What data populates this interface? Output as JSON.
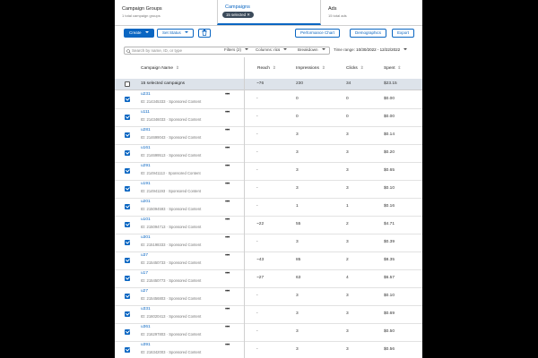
{
  "tabs": {
    "groups": {
      "title": "Campaign Groups",
      "sub": "1 total campaign groups"
    },
    "campaigns": {
      "title": "Campaigns",
      "chip": "15 selected",
      "chip_close": "✕"
    },
    "ads": {
      "title": "Ads",
      "sub": "15 total ads"
    }
  },
  "toolbar": {
    "create": "Create",
    "set_status": "Set Status",
    "delete_icon": "trash-icon",
    "performance_chart": "Performance Chart",
    "demographics": "Demographics",
    "export": "Export"
  },
  "search": {
    "placeholder": "Search by name, ID, or type"
  },
  "filters": {
    "filters_label": "Filters (2)",
    "columns_label": "Columns:",
    "columns_value": "rics",
    "breakdown_label": "Breakdown",
    "time_label": "Time range:",
    "time_value": "10/30/2022 - 12/22/2022"
  },
  "headers": {
    "name": "Campaign Name",
    "reach": "Reach",
    "impressions": "Impressions",
    "clicks": "Clicks",
    "spent": "Spent"
  },
  "summary": {
    "label": "15 selected campaigns",
    "reach": "~76",
    "impressions": "230",
    "clicks": "34",
    "spent": "$23.15"
  },
  "rows": [
    {
      "name": "u231",
      "id": "ID: 214345333 · Sponsored Content",
      "reach": "-",
      "impressions": "0",
      "clicks": "0",
      "spent": "$0.00"
    },
    {
      "name": "u111",
      "id": "ID: 214346033 · Sponsored Content",
      "reach": "-",
      "impressions": "0",
      "clicks": "0",
      "spent": "$0.00"
    },
    {
      "name": "u281",
      "id": "ID: 214699043 · Sponsored Content",
      "reach": "-",
      "impressions": "3",
      "clicks": "3",
      "spent": "$0.14"
    },
    {
      "name": "u161",
      "id": "ID: 214699513 · Sponsored Content",
      "reach": "-",
      "impressions": "3",
      "clicks": "3",
      "spent": "$0.20"
    },
    {
      "name": "u291",
      "id": "ID: 214941113 · Sponsored Content",
      "reach": "-",
      "impressions": "3",
      "clicks": "3",
      "spent": "$0.65"
    },
    {
      "name": "u191",
      "id": "ID: 214941193 · Sponsored Content",
      "reach": "-",
      "impressions": "3",
      "clicks": "3",
      "spent": "$0.10"
    },
    {
      "name": "u201",
      "id": "ID: 215094593 · Sponsored Content",
      "reach": "-",
      "impressions": "1",
      "clicks": "1",
      "spent": "$0.16"
    },
    {
      "name": "u101",
      "id": "ID: 215094713 · Sponsored Content",
      "reach": "~22",
      "impressions": "55",
      "clicks": "2",
      "spent": "$4.71"
    },
    {
      "name": "u301",
      "id": "ID: 215198333 · Sponsored Content",
      "reach": "-",
      "impressions": "3",
      "clicks": "3",
      "spent": "$0.39"
    },
    {
      "name": "u37",
      "id": "ID: 215450733 · Sponsored Content",
      "reach": "~43",
      "impressions": "85",
      "clicks": "2",
      "spent": "$8.35"
    },
    {
      "name": "u17",
      "id": "ID: 215450773 · Sponsored Content",
      "reach": "~27",
      "impressions": "63",
      "clicks": "4",
      "spent": "$6.57"
    },
    {
      "name": "u27",
      "id": "ID: 215456803 · Sponsored Content",
      "reach": "-",
      "impressions": "3",
      "clicks": "3",
      "spent": "$0.10"
    },
    {
      "name": "u331",
      "id": "ID: 216020413 · Sponsored Content",
      "reach": "-",
      "impressions": "3",
      "clicks": "3",
      "spent": "$0.69"
    },
    {
      "name": "u361",
      "id": "ID: 216297803 · Sponsored Content",
      "reach": "-",
      "impressions": "3",
      "clicks": "3",
      "spent": "$0.50"
    },
    {
      "name": "u391",
      "id": "ID: 216342003 · Sponsored Content",
      "reach": "-",
      "impressions": "3",
      "clicks": "3",
      "spent": "$0.56"
    }
  ],
  "colors": {
    "accent": "#0a66c2",
    "summary_bg": "#dde3ea"
  }
}
